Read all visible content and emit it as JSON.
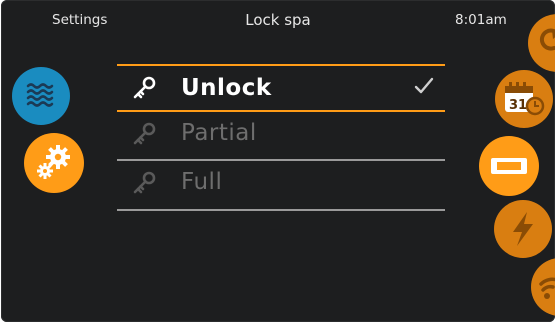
{
  "header": {
    "left_label": "Settings",
    "title": "Lock spa",
    "time": "8:01am"
  },
  "lock_options": [
    {
      "label": "Unlock",
      "selected": true,
      "icon": "key-icon"
    },
    {
      "label": "Partial",
      "selected": false,
      "icon": "key-icon"
    },
    {
      "label": "Full",
      "selected": false,
      "icon": "key-icon"
    }
  ],
  "left_nav": [
    {
      "icon": "water-waves-icon",
      "color": "#1a8cc0"
    },
    {
      "icon": "gears-icon",
      "color": "#ff9c17",
      "active": true
    }
  ],
  "right_nav": [
    {
      "icon": "rotate-arrow-icon",
      "color": "#d97e11"
    },
    {
      "icon": "calendar-clock-icon",
      "color": "#d97e11",
      "calendar_day": "31"
    },
    {
      "icon": "display-screen-icon",
      "color": "#ff9c17",
      "active": true
    },
    {
      "icon": "lightning-icon",
      "color": "#d97e11"
    },
    {
      "icon": "wifi-icon",
      "color": "#d97e11"
    }
  ],
  "colors": {
    "accent": "#ff9c17",
    "background": "#1d1e1f",
    "divider": "#9a9a9a",
    "dim_text": "#6e6e6e"
  }
}
